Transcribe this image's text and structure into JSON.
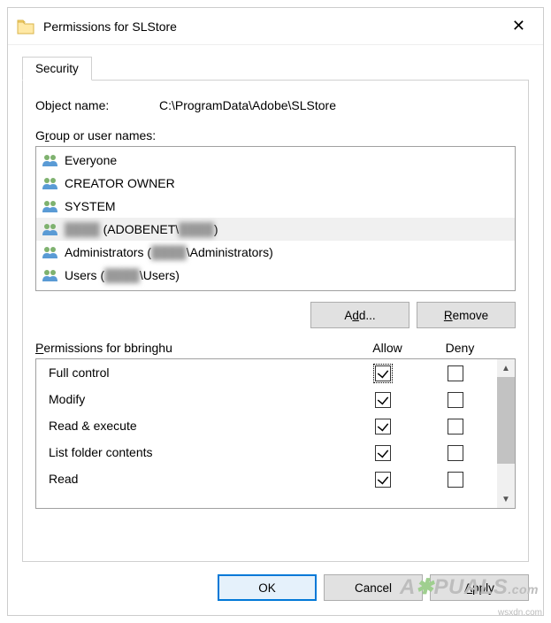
{
  "window": {
    "title": "Permissions for SLStore"
  },
  "tab": {
    "security": "Security"
  },
  "object": {
    "label": "Object name:",
    "value": "C:\\ProgramData\\Adobe\\SLStore"
  },
  "groups": {
    "label_pre": "G",
    "label_ul": "r",
    "label_post": "oup or user names:",
    "items": [
      {
        "text": "Everyone"
      },
      {
        "text": "CREATOR OWNER"
      },
      {
        "text": "SYSTEM"
      },
      {
        "text_pre": "",
        "blur1": "████",
        "text_mid": " (ADOBENET\\",
        "blur2": "████",
        "text_post": ")",
        "selected": true
      },
      {
        "text_pre": "Administrators (",
        "blur1": "████",
        "text_post": "\\Administrators)"
      },
      {
        "text_pre": "Users (",
        "blur1": "████",
        "text_post": "\\Users)"
      }
    ]
  },
  "buttons": {
    "add_pre": "A",
    "add_ul": "d",
    "add_post": "d...",
    "remove_ul": "R",
    "remove_post": "emove",
    "ok": "OK",
    "cancel": "Cancel",
    "apply_ul": "A",
    "apply_post": "pply"
  },
  "perms": {
    "header_pre": "P",
    "header_ul": "e",
    "header_post": "rmissions for bbringhu",
    "col_allow": "Allow",
    "col_deny": "Deny",
    "rows": [
      {
        "name": "Full control",
        "allow": true,
        "deny": false,
        "focus": true
      },
      {
        "name": "Modify",
        "allow": true,
        "deny": false
      },
      {
        "name": "Read & execute",
        "allow": true,
        "deny": false
      },
      {
        "name": "List folder contents",
        "allow": true,
        "deny": false
      },
      {
        "name": "Read",
        "allow": true,
        "deny": false
      }
    ]
  },
  "watermark": "A PUALS",
  "credit": "wsxdn.com"
}
